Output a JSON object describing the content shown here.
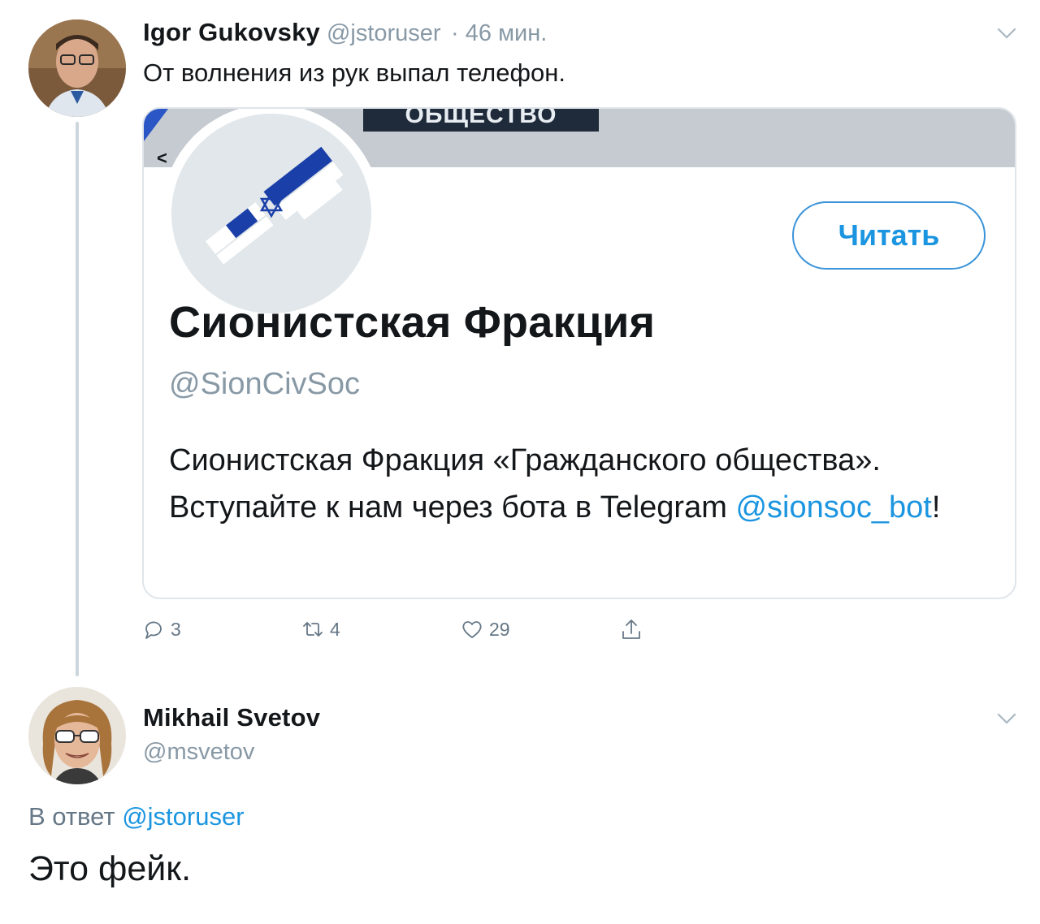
{
  "tweet1": {
    "author_name": "Igor Gukovsky",
    "author_handle": "@jstoruser",
    "time": "· 46 мин.",
    "text": "От волнения из рук выпал телефон.",
    "card": {
      "banner_text": "ОБЩЕСТВО",
      "profile_name": "Сионистская Фракция",
      "profile_handle": "@SionCivSoc",
      "follow_label": "Читать",
      "bio_part1": "Сионистская Фракция «Гражданского общества». Вступайте к нам через бота в Telegram ",
      "bio_link": "@sionsoc_bot",
      "bio_end": "!"
    },
    "actions": {
      "replies": "3",
      "retweets": "4",
      "likes": "29"
    }
  },
  "tweet2": {
    "author_name": "Mikhail Svetov",
    "author_handle": "@msvetov",
    "reply_prefix": "В ответ",
    "reply_to": "@jstoruser",
    "text": "Это фейк."
  },
  "colors": {
    "link": "#1b95e0",
    "muted": "#8899a6",
    "text": "#14171a"
  },
  "icons": [
    "chevron-down-icon",
    "reply-icon",
    "retweet-icon",
    "like-icon",
    "share-icon"
  ]
}
